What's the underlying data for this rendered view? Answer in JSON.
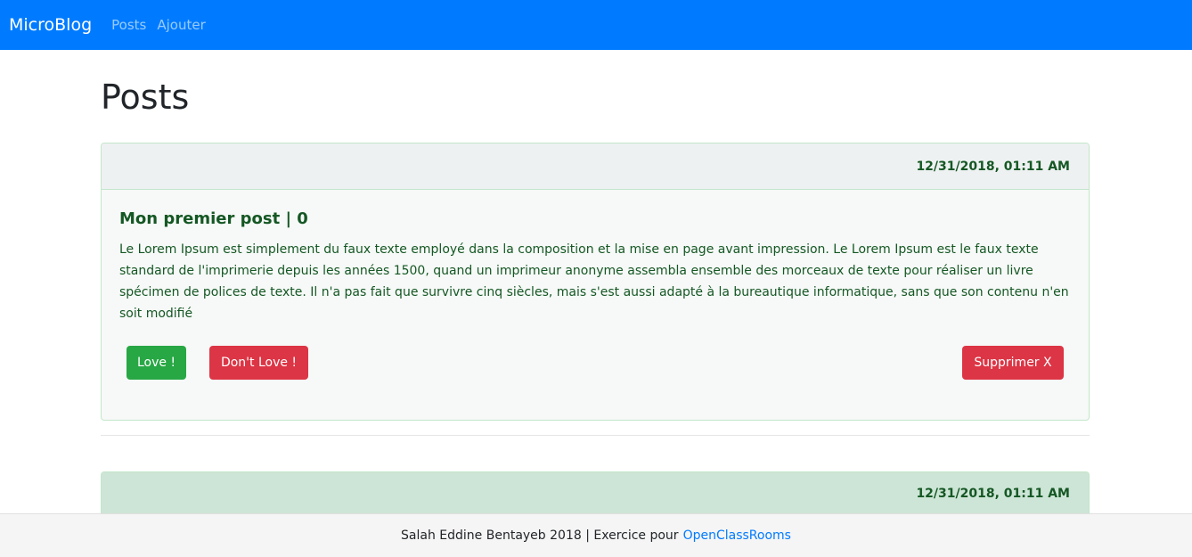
{
  "navbar": {
    "brand": "MicroBlog",
    "links": [
      "Posts",
      "Ajouter"
    ],
    "color": "#007bff"
  },
  "page": {
    "title": "Posts"
  },
  "posts": [
    {
      "date": "12/31/2018, 01:11 AM",
      "title": "Mon premier post | 0",
      "content": "Le Lorem Ipsum est simplement du faux texte employé dans la composition et la mise en page avant impression. Le Lorem Ipsum est le faux texte standard de l'imprimerie depuis les années 1500, quand un imprimeur anonyme assembla ensemble des morceaux de texte pour réaliser un livre spécimen de polices de texte. Il n'a pas fait que survivre cinq siècles, mais s'est aussi adapté à la bureautique informatique, sans que son contenu n'en soit modifié",
      "love_label": "Love !",
      "dont_love_label": "Don't Love !",
      "delete_label": "Supprimer X"
    },
    {
      "date": "12/31/2018, 01:11 AM"
    }
  ],
  "footer": {
    "text": "Salah Eddine Bentayeb 2018 | Exercice pour",
    "link": "OpenClassRooms"
  },
  "colors": {
    "success": "#28a745",
    "danger": "#dc3545",
    "text_success": "#155724"
  }
}
